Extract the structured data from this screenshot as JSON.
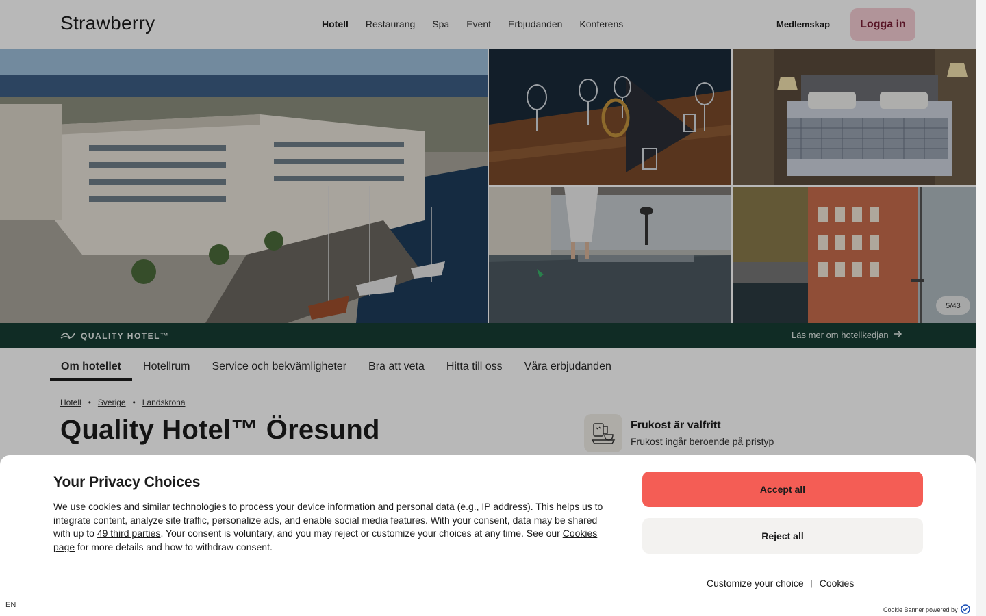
{
  "header": {
    "logo": "Strawberry",
    "nav": [
      {
        "label": "Hotell",
        "active": true
      },
      {
        "label": "Restaurang",
        "active": false
      },
      {
        "label": "Spa",
        "active": false
      },
      {
        "label": "Event",
        "active": false
      },
      {
        "label": "Erbjudanden",
        "active": false
      },
      {
        "label": "Konferens",
        "active": false
      }
    ],
    "membership": "Medlemskap",
    "login": "Logga in"
  },
  "gallery": {
    "counter": "5/43",
    "photos": [
      "hotel-exterior-photo",
      "glassware-photo",
      "bedroom-photo",
      "spa-pool-photo",
      "city-view-photo"
    ]
  },
  "brand_bar": {
    "brand": "QUALITY HOTEL™",
    "more_link": "Läs mer om hotellkedjan"
  },
  "tabs": [
    {
      "label": "Om hotellet",
      "active": true
    },
    {
      "label": "Hotellrum",
      "active": false
    },
    {
      "label": "Service och bekvämligheter",
      "active": false
    },
    {
      "label": "Bra att veta",
      "active": false
    },
    {
      "label": "Hitta till oss",
      "active": false
    },
    {
      "label": "Våra erbjudanden",
      "active": false
    }
  ],
  "breadcrumb": [
    "Hotell",
    "Sverige",
    "Landskrona"
  ],
  "hotel": {
    "title": "Quality Hotel™ Öresund",
    "feature_title": "Frukost är valfritt",
    "feature_subtitle": "Frukost ingår beroende på pristyp"
  },
  "cookie_banner": {
    "title": "Your Privacy Choices",
    "text_1": "We use cookies and similar technologies to process your device information and personal data (e.g., IP address). This helps us to integrate content, analyze site traffic, personalize ads, and enable social media features. With your consent, data may be shared with up to ",
    "third_parties_link": "49 third parties",
    "text_2": ". Your consent is voluntary, and you may reject or customize your choices at any time. See our ",
    "cookies_page_link": "Cookies page",
    "text_3": " for more details and how to withdraw consent.",
    "accept": "Accept all",
    "reject": "Reject all",
    "customize": "Customize your choice",
    "separator": "|",
    "cookies": "Cookies",
    "language": "EN",
    "powered_by": "Cookie Banner powered by"
  },
  "colors": {
    "accept": "#f45d55",
    "login_bg": "#f6cdd4",
    "brand_bar": "#173d34"
  }
}
